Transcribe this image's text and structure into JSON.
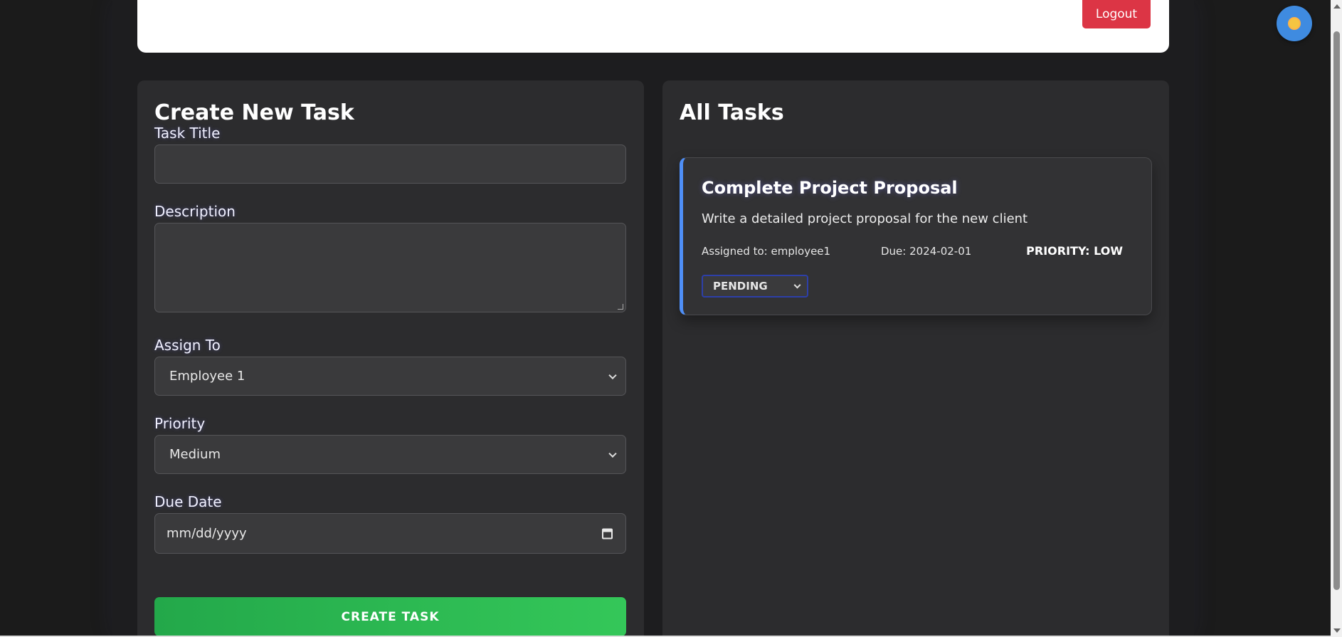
{
  "header": {
    "logout_label": "Logout"
  },
  "create_form": {
    "title": "Create New Task",
    "task_title_label": "Task Title",
    "task_title_value": "",
    "description_label": "Description",
    "description_value": "",
    "assign_label": "Assign To",
    "assign_value": "Employee 1",
    "priority_label": "Priority",
    "priority_value": "Medium",
    "due_label": "Due Date",
    "due_placeholder": "mm/dd/yyyy",
    "submit_label": "CREATE TASK"
  },
  "tasks": {
    "title": "All Tasks",
    "items": [
      {
        "title": "Complete Project Proposal",
        "description": "Write a detailed project proposal for the new client",
        "assigned": "Assigned to: employee1",
        "due": "Due: 2024-02-01",
        "priority": "PRIORITY: LOW",
        "status": "PENDING"
      }
    ]
  },
  "colors": {
    "accent_blue": "#4f8ff7",
    "logout_red": "#dc3545",
    "create_green": "#34c759"
  },
  "icons": {
    "theme_toggle": "sun-icon",
    "dropdown": "chevron-down-icon",
    "date": "calendar-icon"
  }
}
